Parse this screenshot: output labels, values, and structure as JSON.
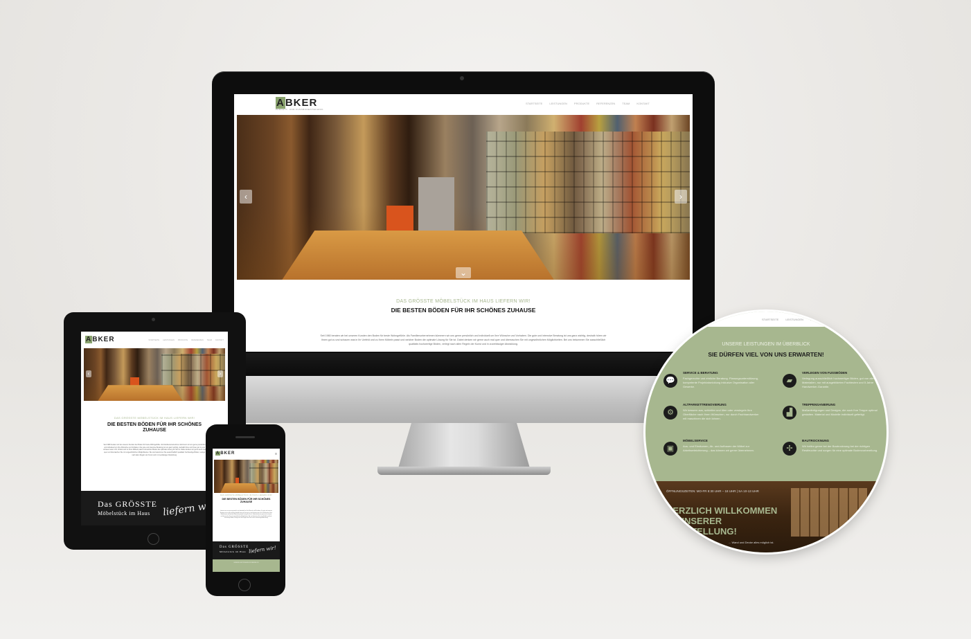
{
  "brand": {
    "logo": "ABKER",
    "logo_first_letter": "A",
    "logo_rest": "BKER",
    "tagline": "PARKETT- UND FUSSBODENTECHNIK",
    "accent": "#a7b78f",
    "dark": "#1a1a1a"
  },
  "nav": {
    "items": [
      "STARTSEITE",
      "LEISTUNGEN",
      "PRODUKTE",
      "REFERENZEN",
      "TEAM",
      "KONTAKT"
    ]
  },
  "hero": {
    "prev_icon": "chevron-left",
    "next_icon": "chevron-right",
    "down_icon": "chevron-down"
  },
  "intro": {
    "subheading": "DAS GRÖSSTE MÖBELSTÜCK IM HAUS LIEFERN WIR!",
    "heading": "DIE BESTEN BÖDEN FÜR IHR SCHÖNES ZUHAUSE",
    "heading_tablet": "DIE BESTEN BÖDEN FÜR IHR SCHÖNES ZUHAUSE",
    "body": "Seit 1980 beraten wir bei unseren Kunden den Boden für beste Wohngefühle. Als Familienunternehmen kümmern wir uns gerne persönlich und individuell um Ihre Wünsche und Vorhaben. Die gute und intensive Beratung ist uns ganz wichtig, deshalb hören wir Ihnen gut zu und schauen was in Ihr Umfeld und zu Ihren Möbeln passt und welcher Boden die optimale Lösung für Sie ist. Dabei denken wir gerne auch mal quer und überraschen Sie mit ungewöhnlichen Möglichkeiten. Bei uns bekommen Sie ausschließlich qualitativ hochwertige Böden, verlegt nach allen Regeln der Kunst und in zuverlässiger Abwicklung."
  },
  "banner": {
    "line1": "Das GRÖSSTE",
    "line2": "Möbelstück im Haus",
    "script": "liefern wir!"
  },
  "services": {
    "subheading": "UNSERE LEISTUNGEN IM ÜBERBLICK",
    "heading": "SIE DÜRFEN VIEL VON UNS ERWARTEN!",
    "items": [
      {
        "title": "SERVICE & BERATUNG",
        "icon": "chat-icon",
        "desc": "Fachgerechte und ehrliche Beratung. Planungsunterstützung, kompetente Projektabwicklung inklusive Organisation aller Gewerke."
      },
      {
        "title": "VERLEGEN VON FUSSBÖDEN",
        "icon": "floor-icon",
        "desc": "Verlegung ausschließlich hochwertiger Böden, gut von allen Materialien, nur mit ausgebildeten Fachleuten und 5 Jahre Handwerker-Garantie."
      },
      {
        "title": "ALTPARKETTRENOVIERUNG",
        "icon": "sander-icon",
        "desc": "Wir bessern aus, schleifen und ölen oder versiegeln Ihre Oberfläche nach Ihren Wünschen, nur durch Fachhandwerker mit maschinen die sich lohnen."
      },
      {
        "title": "TREPPENSANIERUNG",
        "icon": "stairs-icon",
        "desc": "Maßanfertigungen und Designs, die auch Ihre Treppe optimal gestalten. Material und Modelle individuell gefertigt."
      },
      {
        "title": "MÖBELSERVICE",
        "icon": "box-icon",
        "desc": "Aus- und Einräumen, Ab- und Aufbauen der Möbel zur Arbeitserleichterung – das können wir gerne übernehmen."
      },
      {
        "title": "BAUTROCKNUNG",
        "icon": "fan-icon",
        "desc": "Wir helfen gerne bei der Bautrocknung bei der richtigen Restfeuchte und sorgen für eine optimale Bodenvorbereitung."
      }
    ]
  },
  "welcome": {
    "hours": "ÖFFNUNGSZEITEN: MO-FR 8:30 UHR – 18 UHR | SA 10-13 UHR",
    "title_line1": "HERZLICH WILLKOMMEN",
    "title_line2": "IN UNSERER",
    "title_line3": "AUSSTELLUNG!",
    "note": "... Wand und Decke alles möglich ist."
  }
}
